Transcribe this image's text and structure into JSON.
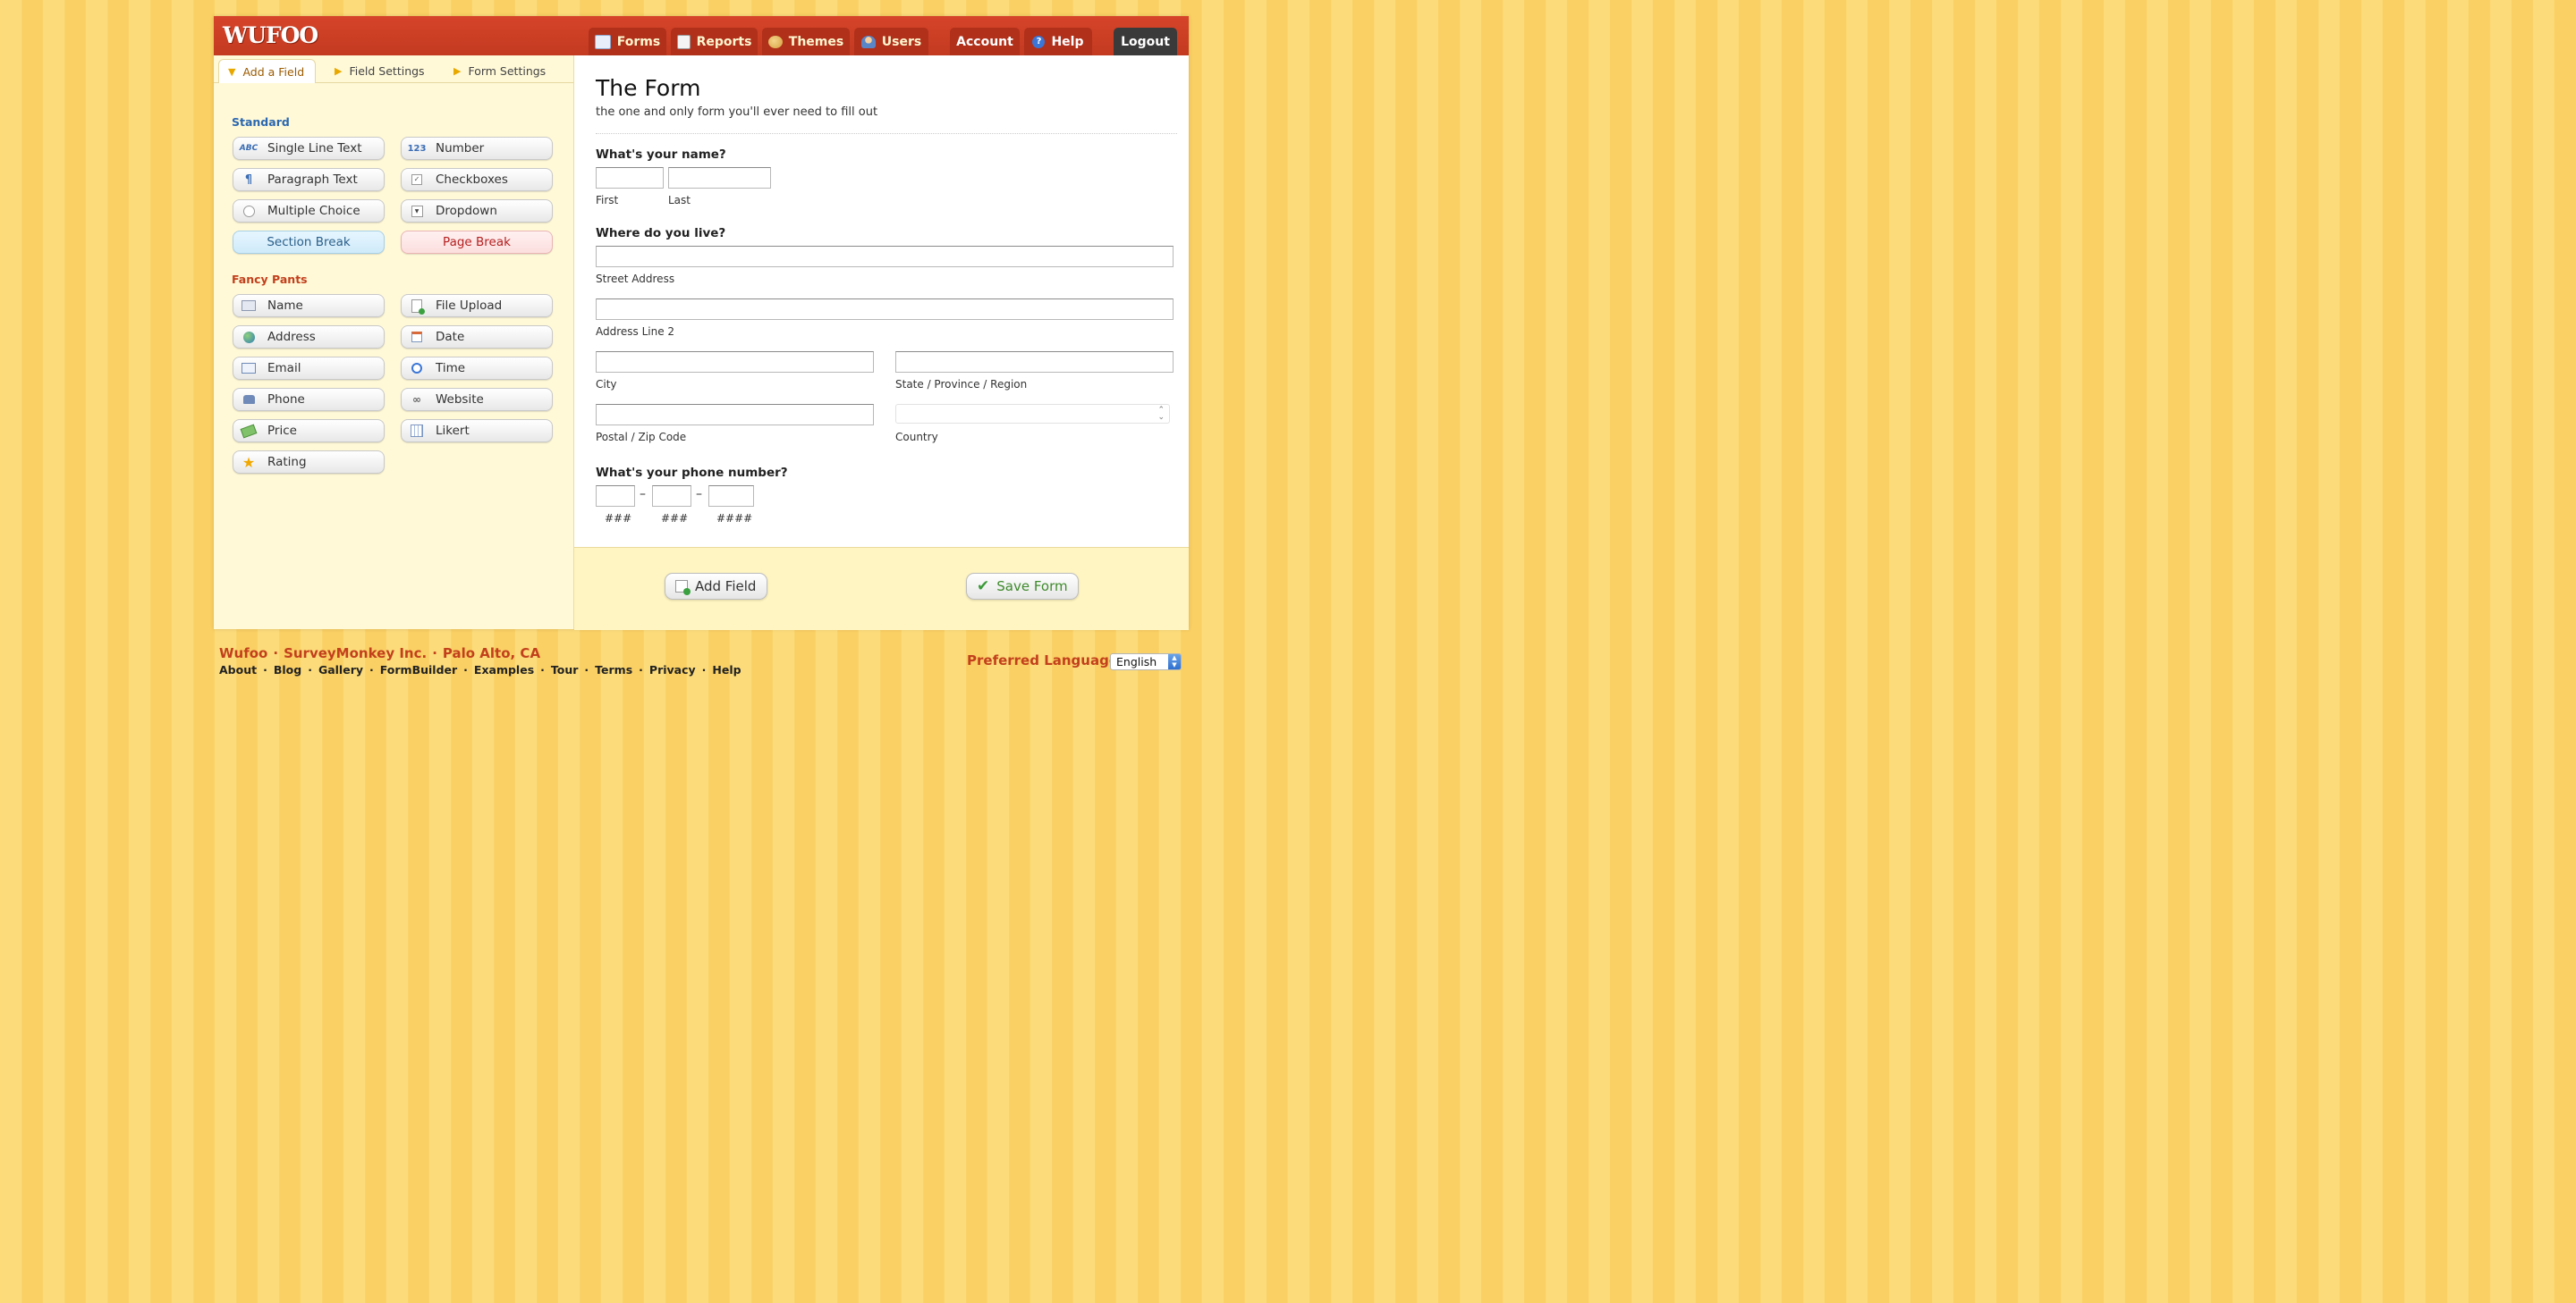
{
  "app": {
    "logo": "WUFOO"
  },
  "nav": {
    "forms": "Forms",
    "reports": "Reports",
    "themes": "Themes",
    "users": "Users",
    "account": "Account",
    "help": "Help",
    "logout": "Logout"
  },
  "sidebar": {
    "tabs": [
      "Add a Field",
      "Field Settings",
      "Form Settings"
    ],
    "standard_title": "Standard",
    "standard": [
      "Single Line Text",
      "Number",
      "Paragraph Text",
      "Checkboxes",
      "Multiple Choice",
      "Dropdown"
    ],
    "icon_text": {
      "abc": "ABC",
      "num": "123"
    },
    "section_break": "Section Break",
    "page_break": "Page Break",
    "fancy_title": "Fancy Pants",
    "fancy": [
      "Name",
      "File Upload",
      "Address",
      "Date",
      "Email",
      "Time",
      "Phone",
      "Website",
      "Price",
      "Likert",
      "Rating"
    ]
  },
  "form": {
    "title": "The Form",
    "description": "the one and only form you'll ever need to fill out",
    "q_name": "What's your name?",
    "first": "First",
    "last": "Last",
    "q_address": "Where do you live?",
    "street": "Street Address",
    "line2": "Address Line 2",
    "city": "City",
    "state": "State / Province / Region",
    "postal": "Postal / Zip Code",
    "country": "Country",
    "q_phone": "What's your phone number?",
    "phone_parts": [
      "###",
      "###",
      "####"
    ],
    "dash": "–"
  },
  "actions": {
    "add_field": "Add Field",
    "save_form": "Save Form"
  },
  "footer": {
    "brand": [
      "Wufoo",
      "SurveyMonkey Inc.",
      "Palo Alto, CA"
    ],
    "links": [
      "About",
      "Blog",
      "Gallery",
      "FormBuilder",
      "Examples",
      "Tour",
      "Terms",
      "Privacy",
      "Help"
    ],
    "separator": "·",
    "pref_language": "Preferred Language :",
    "language": "English"
  },
  "colors": {
    "brand_red": "#c2401c",
    "nav_bar": "#d6442a",
    "sidebar_bg": "#fff9d8",
    "accent_blue": "#2b67b0"
  }
}
